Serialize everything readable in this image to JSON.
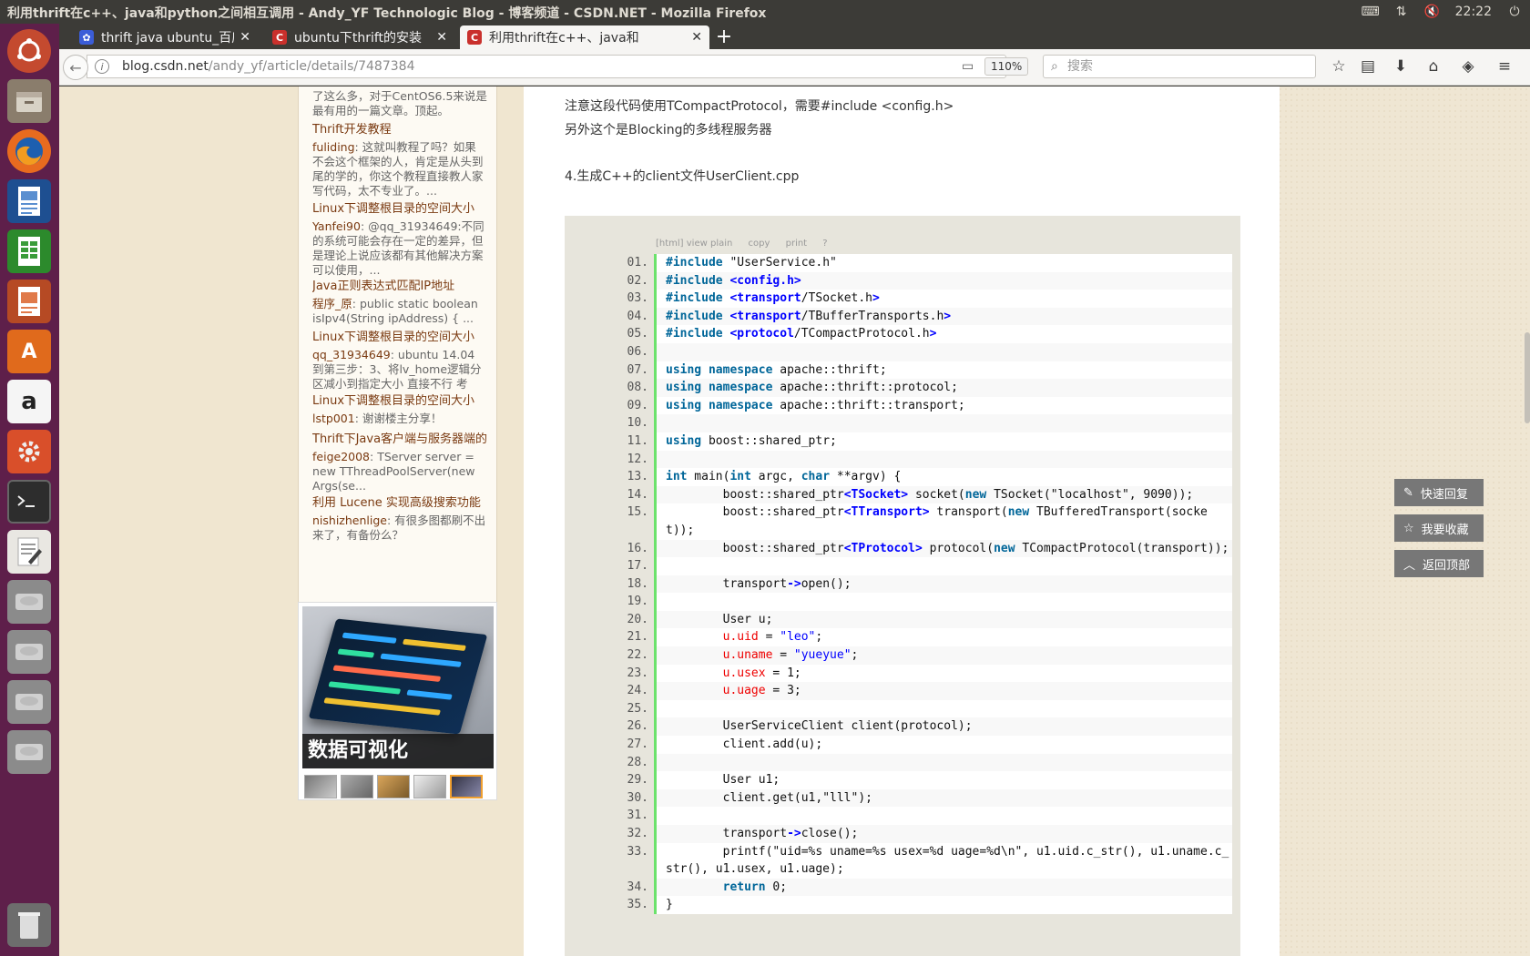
{
  "window": {
    "title": "利用thrift在c++、java和python之间相互调用 - Andy_YF Technologic Blog - 博客频道 - CSDN.NET - Mozilla Firefox"
  },
  "tray": {
    "time": "22:22",
    "icons": [
      "keyboard-icon",
      "network-icon",
      "volume-muted-icon",
      "power-icon"
    ]
  },
  "launcher": [
    "ubuntu-dash-icon",
    "files-icon",
    "firefox-icon",
    "writer-icon",
    "calc-icon",
    "impress-icon",
    "software-center-icon",
    "amazon-icon",
    "settings-icon",
    "terminal-icon",
    "text-editor-icon",
    "drive-icon",
    "drive-icon",
    "drive-icon",
    "drive-icon",
    "trash-icon"
  ],
  "tabs": [
    {
      "label": "thrift java ubuntu_百度",
      "favicon": "baidu"
    },
    {
      "label": "ubuntu下thrift的安装",
      "favicon": "csdn"
    },
    {
      "label": "利用thrift在c++、java和",
      "favicon": "csdn"
    }
  ],
  "nav": {
    "url_host": "blog.csdn.net",
    "url_path": "/andy_yf/article/details/7487384",
    "zoom": "110%",
    "search_placeholder": "搜索"
  },
  "sidebar": {
    "comments": [
      {
        "title": "",
        "user": "",
        "text": "了这么多，对于CentOS6.5来说是最有用的一篇文章。顶起。"
      },
      {
        "title": "Thrift开发教程",
        "user": "fuliding",
        "text": ": 这就叫教程了吗？如果不会这个框架的人，肯定是从头到尾的学的，你这个教程直接教人家写代码，太不专业了。..."
      },
      {
        "title": "Linux下调整根目录的空间大小",
        "user": "Yanfei90",
        "text": ": @qq_31934649:不同的系统可能会存在一定的差异，但是理论上说应该都有其他解决方案可以使用，..."
      },
      {
        "title": "Java正则表达式匹配IP地址",
        "user": "程序_原",
        "text": ": public static boolean isIpv4(String ipAddress) { ..."
      },
      {
        "title": "Linux下调整根目录的空间大小",
        "user": "qq_31934649",
        "text": ": ubuntu 14.04 到第三步：3、将lv_home逻辑分区减小到指定大小 直接不行 考"
      },
      {
        "title": "Linux下调整根目录的空间大小",
        "user": "lstp001",
        "text": ": 谢谢楼主分享！"
      },
      {
        "title": "Thrift下Java客户端与服务器端的",
        "user": "feige2008",
        "text": ": TServer server = new TThreadPoolServer(new Args(se..."
      },
      {
        "title": "利用 Lucene 实现高级搜索功能",
        "user": "nishizhenlige",
        "text": ": 有很多图都刷不出来了，有备份么？"
      }
    ],
    "ad": {
      "caption": "数据可视化"
    }
  },
  "article": {
    "para1": "注意这段代码使用TCompactProtocol，需要#include <config.h>",
    "para2": "另外这个是Blocking的多线程服务器",
    "heading": "4.生成C++的client文件UserClient.cpp",
    "code_toolbar": [
      "[html] view plain",
      "copy",
      "print",
      "?"
    ],
    "code_lines": [
      {
        "n": "01.",
        "code": "#include \"UserService.h\""
      },
      {
        "n": "02.",
        "code": "#include <config.h>"
      },
      {
        "n": "03.",
        "code": "#include <transport/TSocket.h>"
      },
      {
        "n": "04.",
        "code": "#include <transport/TBufferTransports.h>"
      },
      {
        "n": "05.",
        "code": "#include <protocol/TCompactProtocol.h>"
      },
      {
        "n": "06.",
        "code": ""
      },
      {
        "n": "07.",
        "code": "using namespace apache::thrift;"
      },
      {
        "n": "08.",
        "code": "using namespace apache::thrift::protocol;"
      },
      {
        "n": "09.",
        "code": "using namespace apache::thrift::transport;"
      },
      {
        "n": "10.",
        "code": ""
      },
      {
        "n": "11.",
        "code": "using boost::shared_ptr;"
      },
      {
        "n": "12.",
        "code": ""
      },
      {
        "n": "13.",
        "code": "int main(int argc, char **argv) {"
      },
      {
        "n": "14.",
        "code": "        boost::shared_ptr<TSocket> socket(new TSocket(\"localhost\", 9090));"
      },
      {
        "n": "15.",
        "code": "        boost::shared_ptr<TTransport> transport(new TBufferedTransport(socket));"
      },
      {
        "n": "16.",
        "code": "        boost::shared_ptr<TProtocol> protocol(new TCompactProtocol(transport));"
      },
      {
        "n": "17.",
        "code": ""
      },
      {
        "n": "18.",
        "code": "        transport->open();"
      },
      {
        "n": "19.",
        "code": ""
      },
      {
        "n": "20.",
        "code": "        User u;"
      },
      {
        "n": "21.",
        "code": "        u.uid = \"leo\";"
      },
      {
        "n": "22.",
        "code": "        u.uname = \"yueyue\";"
      },
      {
        "n": "23.",
        "code": "        u.usex = 1;"
      },
      {
        "n": "24.",
        "code": "        u.uage = 3;"
      },
      {
        "n": "25.",
        "code": ""
      },
      {
        "n": "26.",
        "code": "        UserServiceClient client(protocol);"
      },
      {
        "n": "27.",
        "code": "        client.add(u);"
      },
      {
        "n": "28.",
        "code": ""
      },
      {
        "n": "29.",
        "code": "        User u1;"
      },
      {
        "n": "30.",
        "code": "        client.get(u1,\"lll\");"
      },
      {
        "n": "31.",
        "code": ""
      },
      {
        "n": "32.",
        "code": "        transport->close();"
      },
      {
        "n": "33.",
        "code": "        printf(\"uid=%s uname=%s usex=%d uage=%d\\n\", u1.uid.c_str(), u1.uname.c_str(), u1.usex, u1.uage);"
      },
      {
        "n": "34.",
        "code": "        return 0;"
      },
      {
        "n": "35.",
        "code": "}"
      }
    ]
  },
  "float_buttons": {
    "reply": "快速回复",
    "favorite": "我要收藏",
    "top": "返回顶部"
  }
}
